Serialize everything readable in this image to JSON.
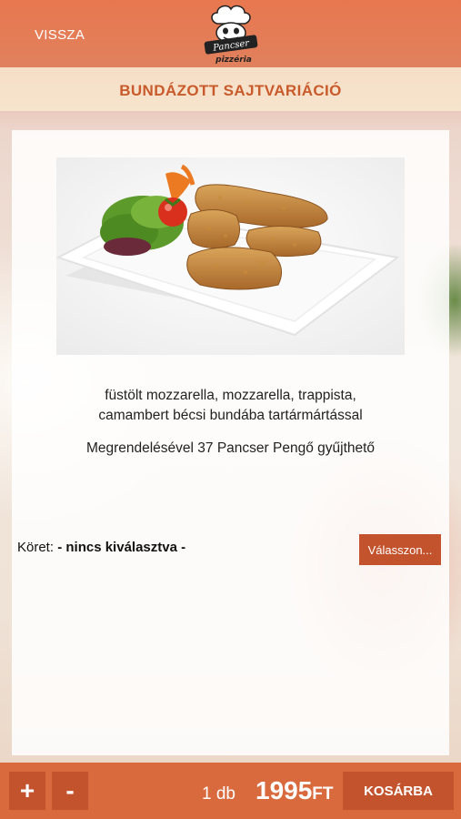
{
  "header": {
    "back_label": "VISSZA",
    "logo_text": "Pancser pizzéria"
  },
  "product": {
    "title": "BUNDÁZOTT SAJTVARIÁCIÓ",
    "description_line1": "füstölt mozzarella, mozzarella, trappista,",
    "description_line2": "camambert bécsi bundába tartármártással",
    "points_text": "Megrendelésével 37 Pancser Pengő gyűjthető",
    "image_icon": "breaded-cheese-plate"
  },
  "side": {
    "label": "Köret:",
    "value": "- nincs kiválasztva -",
    "choose_label": "Válasszon..."
  },
  "footer": {
    "plus_label": "+",
    "minus_label": "-",
    "quantity": "1 db",
    "price": "1995",
    "currency": "FT",
    "cart_label": "KOSÁRBA"
  },
  "colors": {
    "accent": "#c85a2b",
    "button": "#c3532d",
    "bar": "#d96a3d"
  }
}
